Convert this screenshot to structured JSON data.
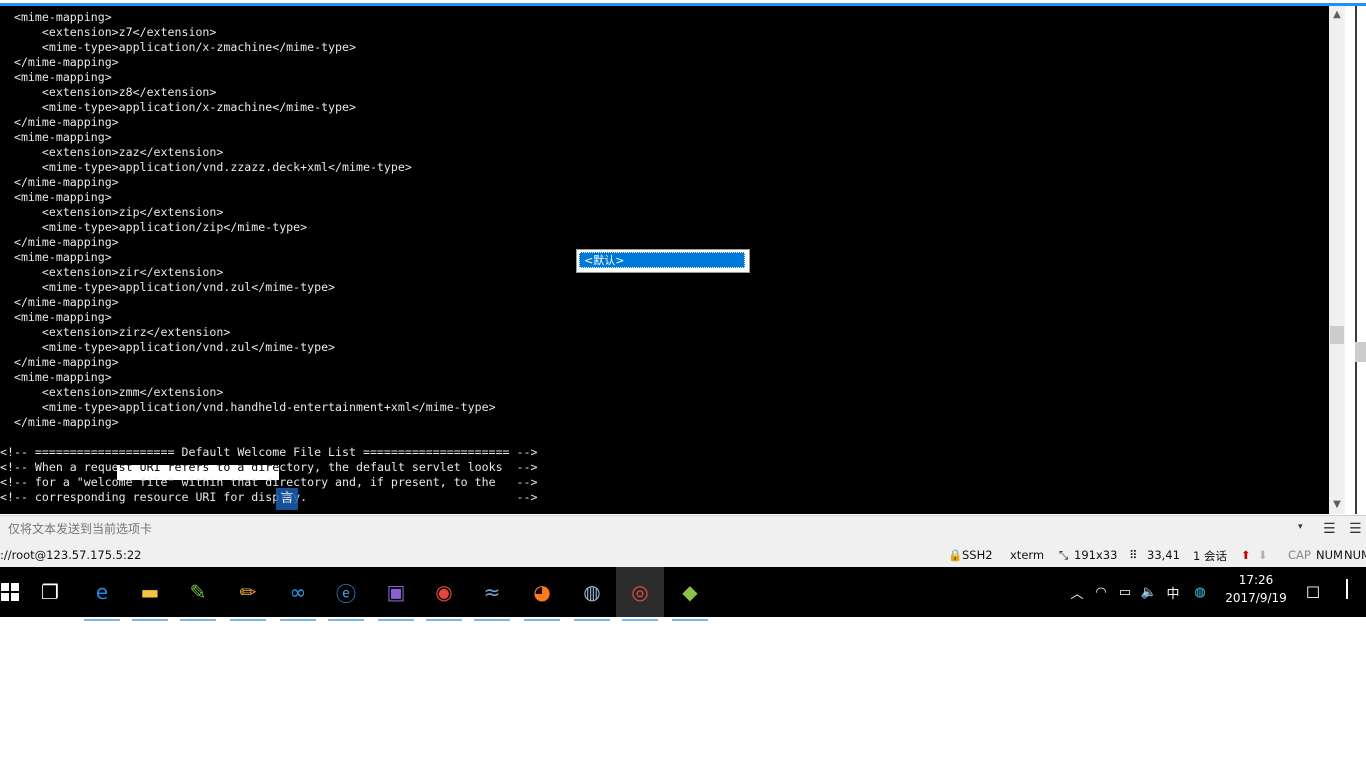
{
  "terminal": {
    "lines": [
      "  <mime-mapping>",
      "      <extension>z7</extension>",
      "      <mime-type>application/x-zmachine</mime-type>",
      "  </mime-mapping>",
      "  <mime-mapping>",
      "      <extension>z8</extension>",
      "      <mime-type>application/x-zmachine</mime-type>",
      "  </mime-mapping>",
      "  <mime-mapping>",
      "      <extension>zaz</extension>",
      "      <mime-type>application/vnd.zzazz.deck+xml</mime-type>",
      "  </mime-mapping>",
      "  <mime-mapping>",
      "      <extension>zip</extension>",
      "      <mime-type>application/zip</mime-type>",
      "  </mime-mapping>",
      "  <mime-mapping>",
      "      <extension>zir</extension>",
      "      <mime-type>application/vnd.zul</mime-type>",
      "  </mime-mapping>",
      "  <mime-mapping>",
      "      <extension>zirz</extension>",
      "      <mime-type>application/vnd.zul</mime-type>",
      "  </mime-mapping>",
      "  <mime-mapping>",
      "      <extension>zmm</extension>",
      "      <mime-type>application/vnd.handheld-entertainment+xml</mime-type>",
      "  </mime-mapping>",
      "",
      "<!-- ==================== Default Welcome File List ===================== -->",
      "<!-- When a request URI refers to a directory, the default servlet looks  -->",
      "<!-- for a \"welcome file\" within that directory and, if present, to the   -->",
      "<!-- corresponding resource URI for display.                              -->"
    ]
  },
  "popup": {
    "item": "<默认>"
  },
  "ime_icon": "言",
  "sendbar": {
    "placeholder": "仅将文本发送到当前选项卡",
    "dropdown_glyph": "▾"
  },
  "statusbar": {
    "session": "://root@123.57.175.5:22",
    "protocol": "SSH2",
    "terminal_type": "xterm",
    "size": "191x33",
    "cursor": "33,41",
    "sessions": "1 会话",
    "cap": "CAP",
    "num": "NUM",
    "num2": "NUM"
  },
  "taskbar": {
    "apps": [
      {
        "icon": "task-view-icon",
        "color": "#ffffff",
        "glyph": "❐"
      },
      {
        "icon": "edge-icon",
        "color": "#1e88e5",
        "glyph": "e"
      },
      {
        "icon": "file-explorer-icon",
        "color": "#f5c242",
        "glyph": "▬"
      },
      {
        "icon": "notepad-plus-icon",
        "color": "#7cc242",
        "glyph": "✎"
      },
      {
        "icon": "paint-icon",
        "color": "#f2a93b",
        "glyph": "✏"
      },
      {
        "icon": "baidu-netdisk-icon",
        "color": "#2aa0f0",
        "glyph": "∞"
      },
      {
        "icon": "ie-icon",
        "color": "#3d9be9",
        "glyph": "ⓔ"
      },
      {
        "icon": "game-icon",
        "color": "#8a5fd0",
        "glyph": "▣"
      },
      {
        "icon": "chrome-icon",
        "color": "#e8453c",
        "glyph": "◉"
      },
      {
        "icon": "dolphin-icon",
        "color": "#6fa8dc",
        "glyph": "≈"
      },
      {
        "icon": "firefox-icon",
        "color": "#ff7a1a",
        "glyph": "◕"
      },
      {
        "icon": "globe-icon",
        "color": "#9fb6d9",
        "glyph": "◍"
      },
      {
        "icon": "securecrt-icon",
        "color": "#e74c3c",
        "glyph": "◎"
      },
      {
        "icon": "green-app-icon",
        "color": "#8bc34a",
        "glyph": "◆"
      }
    ],
    "clock_time": "17:26",
    "clock_date": "2017/9/19",
    "ime_lang": "中",
    "tray_chevron": "︿",
    "tray_network": "◠",
    "tray_battery": "▭",
    "tray_volume": "🔈",
    "tray_app": "◍",
    "notifications": "☐"
  }
}
